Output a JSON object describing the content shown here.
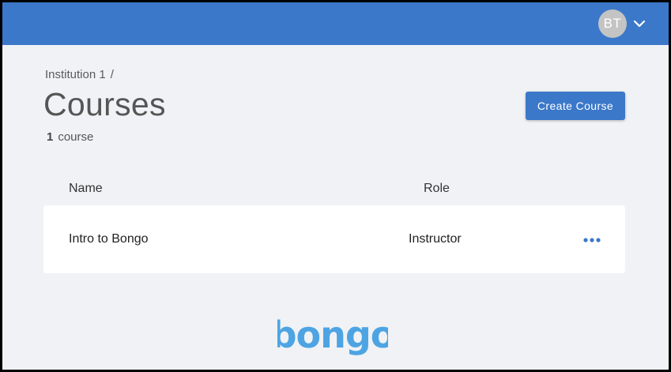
{
  "header": {
    "avatar_initials": "BT",
    "menu_icon": "chevron-down-icon",
    "bar_color": "#3b78c9"
  },
  "breadcrumb": {
    "institution": "Institution 1",
    "separator": "/"
  },
  "page": {
    "title": "Courses",
    "count_number": "1",
    "count_label": "course",
    "create_button_label": "Create Course"
  },
  "table": {
    "columns": [
      "Name",
      "Role"
    ],
    "rows": [
      {
        "name": "Intro to Bongo",
        "role": "Instructor",
        "action_icon": "more-horizontal-icon"
      }
    ]
  },
  "footer": {
    "logo_text": "bongo",
    "logo_color": "#4ea4e3"
  },
  "colors": {
    "accent": "#3b78c9",
    "background": "#f0f2f5",
    "row_background": "#ffffff"
  }
}
